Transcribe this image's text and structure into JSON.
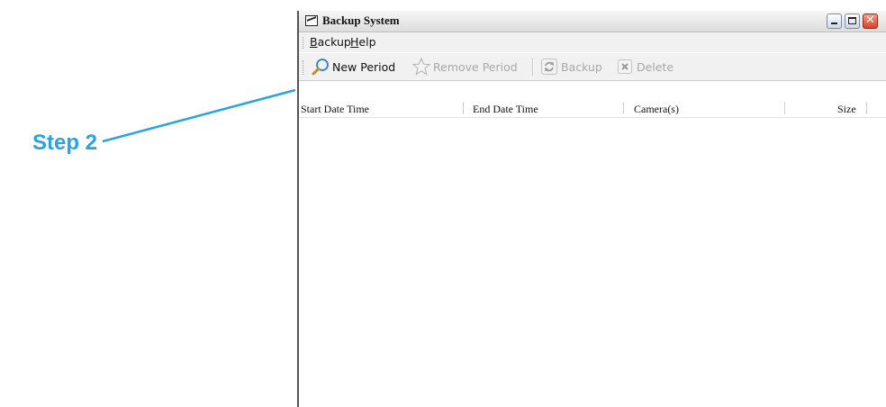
{
  "annotation": {
    "step_label": "Step 2",
    "color": "#2aa3e0"
  },
  "window": {
    "title": "Backup System",
    "controls": [
      "minimize-icon",
      "maximize-icon",
      "close-icon"
    ]
  },
  "menu": {
    "items": [
      "Backup",
      "Help"
    ]
  },
  "toolbar": {
    "new_period": "New Period",
    "remove_period": "Remove Period",
    "backup": "Backup",
    "delete": "Delete",
    "enabled": {
      "new_period": true,
      "remove_period": false,
      "backup": false,
      "delete": false
    }
  },
  "table": {
    "columns": [
      "Start Date Time",
      "End Date Time",
      "Camera(s)",
      "Size"
    ],
    "rows": []
  }
}
